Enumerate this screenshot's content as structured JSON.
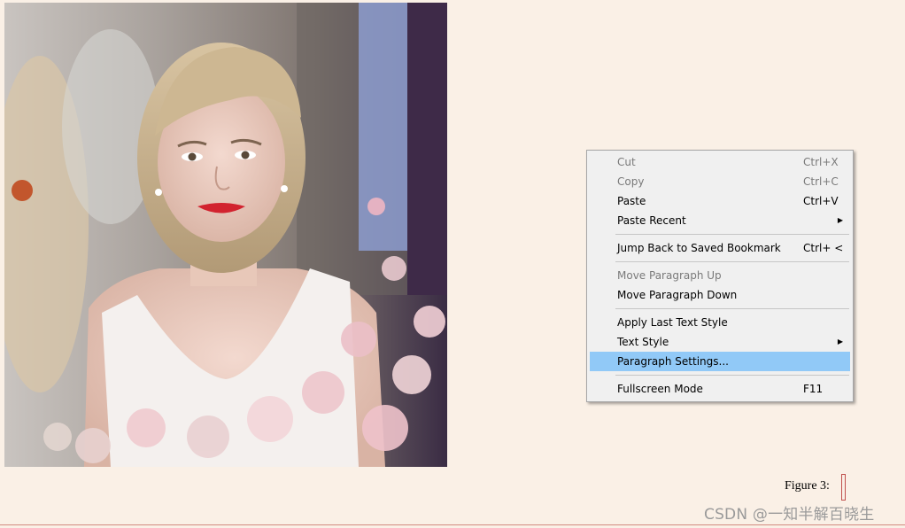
{
  "menu": {
    "items": [
      {
        "id": "cut",
        "label": "Cut",
        "shortcut": "Ctrl+X",
        "disabled": true
      },
      {
        "id": "copy",
        "label": "Copy",
        "shortcut": "Ctrl+C",
        "disabled": true
      },
      {
        "id": "paste",
        "label": "Paste",
        "shortcut": "Ctrl+V"
      },
      {
        "id": "paste-recent",
        "label": "Paste Recent",
        "submenu": true
      },
      {
        "id": "jump-back",
        "label": "Jump Back to Saved Bookmark",
        "shortcut": "Ctrl+ <"
      },
      {
        "id": "move-up",
        "label": "Move Paragraph Up",
        "disabled": true
      },
      {
        "id": "move-down",
        "label": "Move Paragraph Down"
      },
      {
        "id": "apply-last-style",
        "label": "Apply Last Text Style"
      },
      {
        "id": "text-style",
        "label": "Text Style",
        "submenu": true
      },
      {
        "id": "paragraph-settings",
        "label": "Paragraph Settings...",
        "highlighted": true
      },
      {
        "id": "fullscreen",
        "label": "Fullscreen Mode",
        "shortcut": "F11"
      }
    ]
  },
  "caption": {
    "text": "Figure 3:"
  },
  "watermark": {
    "text": "CSDN @一知半解百晓生"
  },
  "colors": {
    "page_background": "#faf0e6",
    "menu_background": "#f0f0f0",
    "menu_highlight": "#91c9f7"
  }
}
